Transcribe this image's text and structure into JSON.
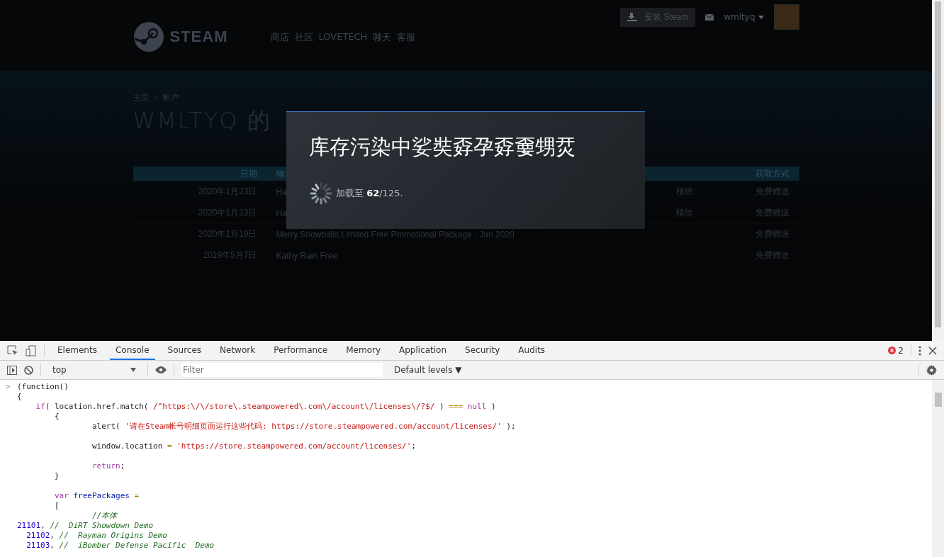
{
  "steam": {
    "logo_text": "STEAM",
    "nav": [
      "商店",
      "社区",
      "LOVETECH",
      "聊天",
      "客服"
    ],
    "install_button": "安装 Steam",
    "username": "wmltyq",
    "breadcrumb": [
      "主页",
      "帐户"
    ],
    "breadcrumb_separator": "›",
    "page_title": "WMLTYQ 的",
    "table": {
      "columns": [
        "日期",
        "物",
        "获取方式"
      ],
      "rows": [
        {
          "date": "2020年1月23日",
          "item": "Ha",
          "remove": "移除",
          "method": "免费赠送"
        },
        {
          "date": "2020年1月23日",
          "item": "Ha",
          "remove": "移除",
          "method": "免费赠送"
        },
        {
          "date": "2020年1月19日",
          "item": "Merry Snowballs Limited Free Promotional Package - Jan 2020",
          "method": "免费赠送"
        },
        {
          "date": "2019年5月7日",
          "item": "Kathy Rain Free",
          "method": "免费赠送"
        }
      ]
    },
    "dialog": {
      "title": "库存污染中娑奘孬孕孬嫑甥烎",
      "progress_label": "加载至 **62**/125."
    }
  },
  "devtools": {
    "tabs": [
      {
        "label": "Elements",
        "selected": false
      },
      {
        "label": "Console",
        "selected": true
      },
      {
        "label": "Sources",
        "selected": false
      },
      {
        "label": "Network",
        "selected": false
      },
      {
        "label": "Performance",
        "selected": false
      },
      {
        "label": "Memory",
        "selected": false
      },
      {
        "label": "Application",
        "selected": false
      },
      {
        "label": "Security",
        "selected": false
      },
      {
        "label": "Audits",
        "selected": false
      }
    ],
    "error_count": "2",
    "context": "top",
    "filter": {
      "placeholder": "Filter"
    },
    "levels": "Default levels ▼",
    "prompt": ">",
    "lines": [
      {
        "kind": "code",
        "tokens": [
          {
            "kind": "plain",
            "t": "(function()"
          }
        ]
      },
      {
        "kind": "code",
        "tokens": [
          {
            "kind": "plain",
            "t": "{"
          }
        ]
      },
      {
        "kind": "code",
        "tokens": [
          {
            "kind": "keyword",
            "t": "    if"
          },
          {
            "kind": "plain",
            "t": "( location.href.match( "
          },
          {
            "kind": "string",
            "t": "/^https:\\/\\/store\\.steampowered\\.com\\/account\\/licenses\\/?$/"
          },
          {
            "kind": "plain",
            "t": " ) "
          },
          {
            "kind": "operator",
            "t": "==="
          },
          {
            "kind": "keyword",
            "t": " null"
          },
          {
            "kind": "plain",
            "t": " )"
          }
        ]
      },
      {
        "kind": "code",
        "tokens": [
          {
            "kind": "plain",
            "t": "        {"
          }
        ]
      },
      {
        "kind": "code",
        "tokens": [
          {
            "kind": "plain",
            "t": "                alert( "
          },
          {
            "kind": "string",
            "t": "'请在Steam帐号明细页面运行这些代码: https://store.steampowered.com/account/licenses/'"
          },
          {
            "kind": "plain",
            "t": " );"
          }
        ]
      },
      {
        "kind": "blank"
      },
      {
        "kind": "code",
        "tokens": [
          {
            "kind": "plain",
            "t": "                window.location "
          },
          {
            "kind": "operator",
            "t": "="
          },
          {
            "kind": "string",
            "t": " 'https://store.steampowered.com/account/licenses/'"
          },
          {
            "kind": "plain",
            "t": ";"
          }
        ]
      },
      {
        "kind": "blank"
      },
      {
        "kind": "code",
        "tokens": [
          {
            "kind": "keyword",
            "t": "                return"
          },
          {
            "kind": "plain",
            "t": ";"
          }
        ]
      },
      {
        "kind": "code",
        "tokens": [
          {
            "kind": "plain",
            "t": "        }"
          }
        ]
      },
      {
        "kind": "blank"
      },
      {
        "kind": "code",
        "tokens": [
          {
            "kind": "keyword",
            "t": "        var"
          },
          {
            "kind": "variable",
            "t": " freePackages"
          },
          {
            "kind": "operator",
            "t": " ="
          }
        ]
      },
      {
        "kind": "code",
        "tokens": [
          {
            "kind": "plain",
            "t": "        ["
          }
        ]
      },
      {
        "kind": "code",
        "tokens": [
          {
            "kind": "comment",
            "t": "                //本体"
          }
        ]
      },
      {
        "kind": "code",
        "tokens": [
          {
            "kind": "number",
            "t": "21101"
          },
          {
            "kind": "plain",
            "t": ", "
          },
          {
            "kind": "comment",
            "t": "//  DiRT Showdown Demo"
          }
        ]
      },
      {
        "kind": "code",
        "tokens": [
          {
            "kind": "number",
            "t": "  21102"
          },
          {
            "kind": "plain",
            "t": ", "
          },
          {
            "kind": "comment",
            "t": "//  Rayman Origins Demo"
          }
        ]
      },
      {
        "kind": "code",
        "tokens": [
          {
            "kind": "number",
            "t": "  21103"
          },
          {
            "kind": "plain",
            "t": ", "
          },
          {
            "kind": "comment",
            "t": "//  iBomber Defense Pacific  Demo"
          }
        ]
      }
    ]
  }
}
